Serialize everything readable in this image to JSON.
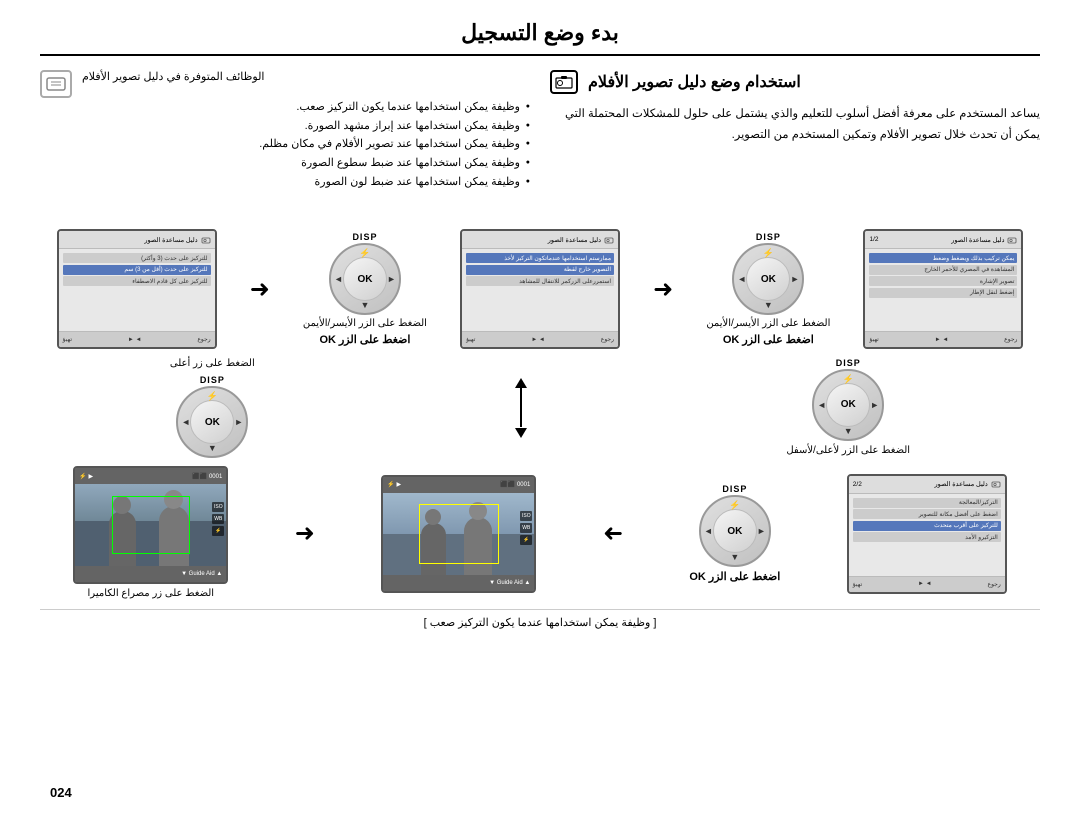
{
  "page": {
    "title": "بدء وضع التسجيل",
    "page_number": "024",
    "section_title": "استخدام وضع دليل تصوير الأفلام",
    "main_info": "يساعد المستخدم على معرفة أفضل أسلوب للتعليم والذي يشتمل على حلول للمشكلات المحتملة التي يمكن أن تحدث خلال تصوير الأفلام وتمكين المستخدم من التصوير.",
    "right_functions_title": "الوظائف المتوفرة في دليل تصوير الأفلام",
    "bullets": [
      "وظيفة يمكن استخدامها عندما يكون التركيز صعب.",
      "وظيفة يمكن استخدامها عند إبراز مشهد الصورة.",
      "وظيفة يمكن استخدامها عند تصوير الأفلام في مكان مظلم.",
      "وظيفة يمكن استخدامها عند ضبط سطوع الصورة",
      "وظيفة يمكن استخدامها عند ضبط لون الصورة"
    ],
    "disp_label": "DISP",
    "ok_label": "OK",
    "captions": {
      "press_lr": "الضغط على الزر الأيسر/الأيمن",
      "press_ok_top": "اضغط على الزر OK",
      "press_ok_mid": "اضغط على الزر OK",
      "press_up": "الضغط على زر أعلى",
      "press_down_up": "الضغط على الزر لأعلى/لأسفل",
      "press_camera": "الضغط على زر مصراع الكاميرا",
      "press_ok_bottom": "اضغط على الزر OK",
      "bottom_note": "[ وظيفة يمكن استخدامها عندما يكون التركيز صعب ]"
    },
    "lcd_screens": {
      "screen1": {
        "title": "دليل مساعدة الصور",
        "page": "1/2",
        "items": [
          "يمكن تركيب بذلك ويضغط وضعط",
          "المشاهدة في المصري للأحمر الخارج",
          "تصوير الإشارة",
          "إضغط لنقل الإطار"
        ]
      },
      "screen2": {
        "title": "دليل مساعدة الصور",
        "page": "",
        "items": [
          "ممارستم استخدامها عندماتكون التصوير لأخذ لقطة خارج",
          "استمررعلى الزركمر للانتقال للمشاهد رأيحها"
        ]
      },
      "screen3": {
        "title": "دليل مساعدة الصور",
        "page": "",
        "items": [
          "للتركيز على حدث (3 وأكثر)",
          "للتركيز على حدث (أقل من 3) سم",
          "للتركيز على كل قادم الاصطفاء"
        ]
      },
      "screen4": {
        "title": "دليل مساعدة الصور",
        "page": "2/2",
        "items": [
          "التركيز/المعالجة",
          "اضغط على أفضل مكانة للتصوير",
          "للتركيز على أقرب متحدث",
          "التزكيرو الأمد"
        ]
      }
    },
    "photo_bars": {
      "top": "0001  ⬜ ⬜",
      "bottom": "▲ Guide Aid ▼"
    }
  }
}
